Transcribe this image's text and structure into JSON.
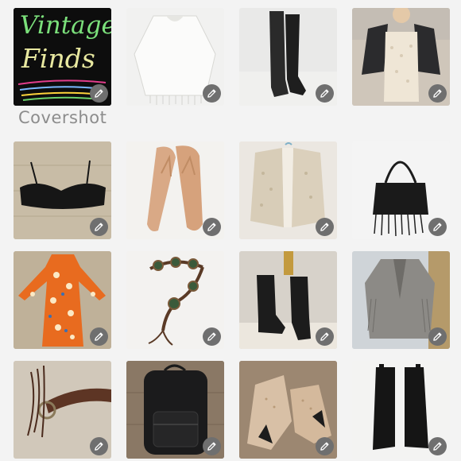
{
  "cover": {
    "line1": "Vintage",
    "line2": "Finds",
    "label": "Covershot"
  },
  "tiles": [
    {
      "name": "cover-photo-tile"
    },
    {
      "name": "white-crochet-poncho-tile"
    },
    {
      "name": "black-cowboy-boots-tile"
    },
    {
      "name": "lace-romper-leather-jacket-tile"
    },
    {
      "name": "black-lace-bra-tile"
    },
    {
      "name": "tan-flip-flops-tile"
    },
    {
      "name": "sequin-bolero-tile"
    },
    {
      "name": "beaded-fringe-bag-tile"
    },
    {
      "name": "orange-floral-dress-tile"
    },
    {
      "name": "concho-belt-tile"
    },
    {
      "name": "black-western-boots-tile"
    },
    {
      "name": "suede-fringe-jacket-tile"
    },
    {
      "name": "brown-leather-belt-tile"
    },
    {
      "name": "black-leather-backpack-tile"
    },
    {
      "name": "studded-ankle-booties-tile"
    },
    {
      "name": "black-chelsea-boots-tile"
    }
  ],
  "colors": {
    "edit_button": "#6f6f6f",
    "label": "#8c8c8c",
    "background": "#f3f3f3"
  },
  "icons": {
    "edit": "pencil-icon"
  }
}
